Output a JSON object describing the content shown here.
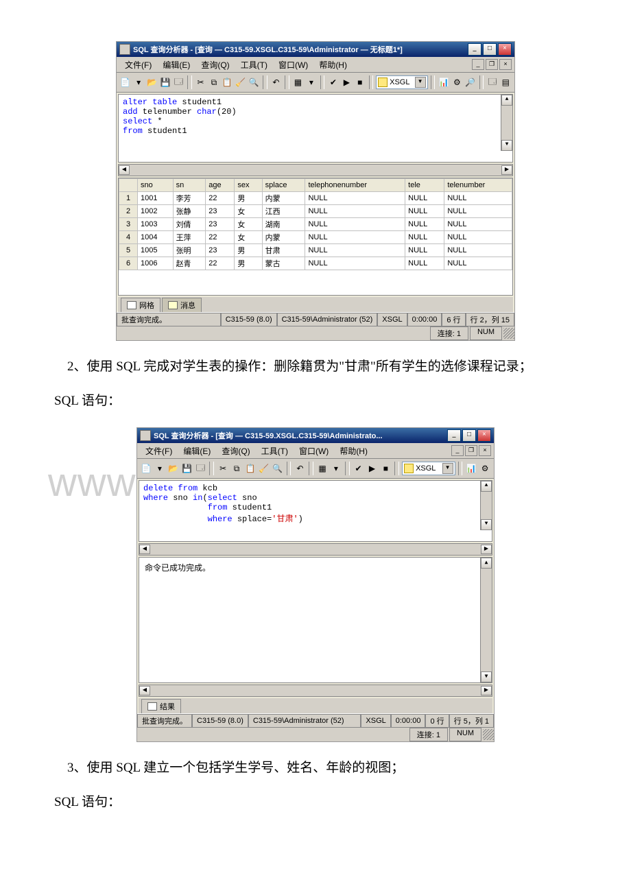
{
  "text": {
    "p2": "2、使用 SQL 完成对学生表的操作：删除籍贯为\"甘肃\"所有学生的选修课程记录；",
    "sqlLabel": "SQL 语句：",
    "p3": "3、使用 SQL 建立一个包括学生学号、姓名、年龄的视图；",
    "watermark": "www.bdocx.com"
  },
  "menus": {
    "file": "文件(F)",
    "edit": "编辑(E)",
    "query": "查询(Q)",
    "tools": "工具(T)",
    "window": "窗口(W)",
    "help": "帮助(H)"
  },
  "db": {
    "name": "XSGL"
  },
  "screenshot1": {
    "title": "SQL 查询分析器 - [查询 — C315-59.XSGL.C315-59\\Administrator — 无标题1*]",
    "sql": {
      "l1a": "alter",
      "l1b": " table",
      "l1c": " student1",
      "l2a": "add",
      "l2b": " telenumber",
      "l2c": " char",
      "l2d": "(20)",
      "l3a": "select",
      "l3b": " *",
      "l4a": "from",
      "l4b": " student1"
    },
    "cols": [
      "sno",
      "sn",
      "age",
      "sex",
      "splace",
      "telephonenumber",
      "tele",
      "telenumber"
    ],
    "rows": [
      {
        "n": "1",
        "sno": "1001",
        "sn": "李芳",
        "age": "22",
        "sex": "男",
        "splace": "内蒙",
        "c6": "NULL",
        "c7": "NULL",
        "c8": "NULL"
      },
      {
        "n": "2",
        "sno": "1002",
        "sn": "张静",
        "age": "23",
        "sex": "女",
        "splace": "江西",
        "c6": "NULL",
        "c7": "NULL",
        "c8": "NULL"
      },
      {
        "n": "3",
        "sno": "1003",
        "sn": "刘倩",
        "age": "23",
        "sex": "女",
        "splace": "湖南",
        "c6": "NULL",
        "c7": "NULL",
        "c8": "NULL"
      },
      {
        "n": "4",
        "sno": "1004",
        "sn": "王萍",
        "age": "22",
        "sex": "女",
        "splace": "内蒙",
        "c6": "NULL",
        "c7": "NULL",
        "c8": "NULL"
      },
      {
        "n": "5",
        "sno": "1005",
        "sn": "张明",
        "age": "23",
        "sex": "男",
        "splace": "甘肃",
        "c6": "NULL",
        "c7": "NULL",
        "c8": "NULL"
      },
      {
        "n": "6",
        "sno": "1006",
        "sn": "赵青",
        "age": "22",
        "sex": "男",
        "splace": "蒙古",
        "c6": "NULL",
        "c7": "NULL",
        "c8": "NULL"
      }
    ],
    "tabs": {
      "grid": "网格",
      "msg": "消息"
    },
    "status": {
      "done": "批查询完成。",
      "server": "C315-59 (8.0)",
      "user": "C315-59\\Administrator (52)",
      "db": "XSGL",
      "time": "0:00:00",
      "rows": "6 行",
      "pos": "行 2，列 15",
      "conn": "连接: 1",
      "num": "NUM"
    }
  },
  "screenshot2": {
    "title": "SQL 查询分析器 - [查询 — C315-59.XSGL.C315-59\\Administrato...",
    "sql": {
      "l1a": "delete",
      "l1b": " from",
      "l1c": " kcb",
      "l2a": "where",
      "l2b": " sno ",
      "l2c": "in",
      "l2d": "(",
      "l2e": "select",
      "l2f": " sno",
      "l3a": "from",
      "l3b": " student1",
      "l4a": "where",
      "l4b": " splace=",
      "l4c": "'甘肃'",
      "l4d": ")"
    },
    "msg": "命令已成功完成。",
    "tabs": {
      "result": "结果"
    },
    "status": {
      "done": "批查询完成。",
      "server": "C315-59 (8.0)",
      "user": "C315-59\\Administrator (52)",
      "db": "XSGL",
      "time": "0:00:00",
      "rows": "0 行",
      "pos": "行 5，列 1",
      "conn": "连接: 1",
      "num": "NUM"
    }
  }
}
